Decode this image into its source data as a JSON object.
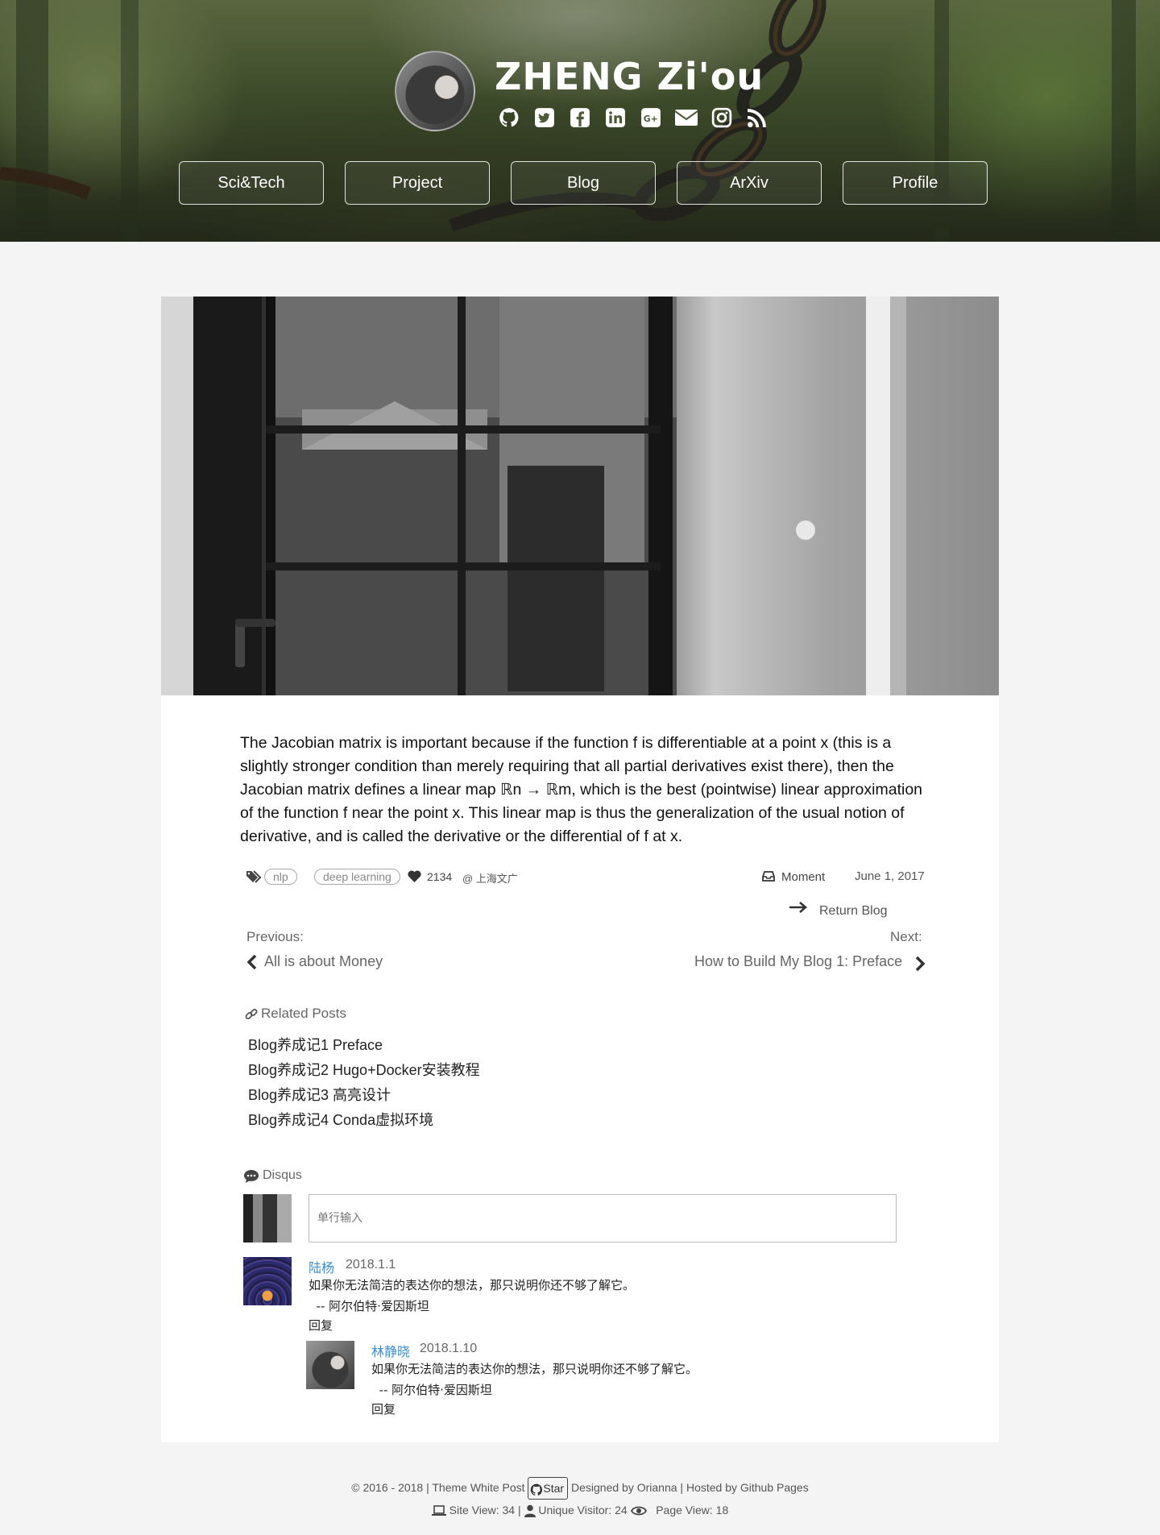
{
  "header": {
    "title": "ZHENG Zi'ou",
    "social_icons": [
      "github-icon",
      "twitter-icon",
      "facebook-icon",
      "linkedin-icon",
      "google-plus-icon",
      "mail-icon",
      "instagram-icon",
      "rss-icon"
    ],
    "nav": [
      "Sci&Tech",
      "Project",
      "Blog",
      "ArXiv",
      "Profile"
    ]
  },
  "post": {
    "body": "The Jacobian matrix is important because if the function f is differentiable at a point x (this is a slightly stronger condition than merely requiring that all partial derivatives exist there), then the Jacobian matrix defines a linear map ℝn → ℝm, which is the best (pointwise) linear approximation of the function f near the point x. This linear map is thus the generalization of the usual notion of derivative, and is called the derivative or the differential of f at x.",
    "tags": [
      "nlp",
      "deep learning"
    ],
    "likes": "2134",
    "location": "@ 上海文广",
    "category": "Moment",
    "date": "June 1, 2017"
  },
  "navigation": {
    "return_label": "Return Blog",
    "previous_label": "Previous:",
    "previous_title": "All is about Money",
    "next_label": "Next:",
    "next_title": "How to Build My Blog 1: Preface"
  },
  "related": {
    "heading": "Related Posts",
    "items": [
      "Blog养成记1 Preface",
      "Blog养成记2 Hugo+Docker安装教程",
      "Blog养成记3 高亮设计",
      "Blog养成记4 Conda虚拟环境"
    ]
  },
  "comments": {
    "heading": "Disqus",
    "input_placeholder": "单行输入",
    "list": [
      {
        "name": "陆杨",
        "date": "2018.1.1",
        "line1": "如果你无法简洁的表达你的想法，那只说明你还不够了解它。",
        "line2": "  -- 阿尔伯特·爱因斯坦",
        "reply": "回复"
      },
      {
        "name": "林静晓",
        "date": "2018.1.10",
        "line1": "如果你无法简洁的表达你的想法，那只说明你还不够了解它。",
        "line2": "  -- 阿尔伯特·爱因斯坦",
        "reply": "回复"
      }
    ]
  },
  "footer": {
    "copyright": "© 2016 - 2018 | Theme White Post",
    "star": "Star",
    "designed": "Designed by Orianna |",
    "hosted": "Hosted by Github Pages",
    "site_view": "Site View: 34 |",
    "unique_visitor": "Unique Visitor: 24",
    "page_view": "Page View: 18"
  }
}
